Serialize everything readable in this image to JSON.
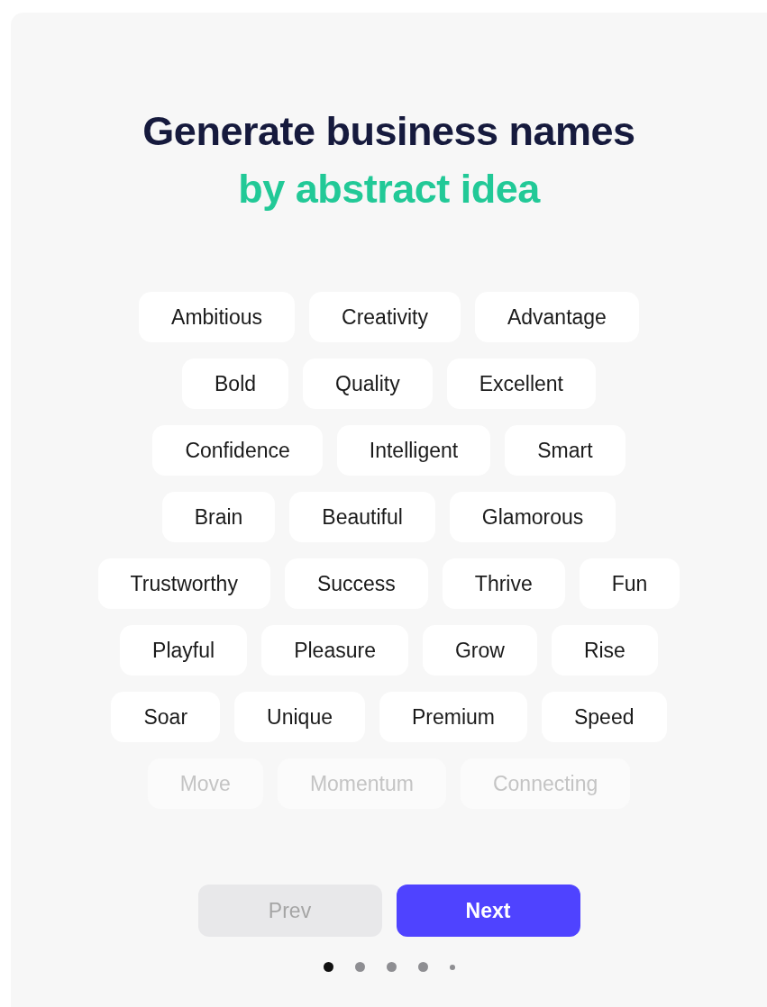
{
  "title": {
    "line1": "Generate business names",
    "line2": "by abstract idea"
  },
  "tag_rows": [
    {
      "tags": [
        {
          "label": "Ambitious",
          "faded": false
        },
        {
          "label": "Creativity",
          "faded": false
        },
        {
          "label": "Advantage",
          "faded": false
        }
      ]
    },
    {
      "tags": [
        {
          "label": "Bold",
          "faded": false
        },
        {
          "label": "Quality",
          "faded": false
        },
        {
          "label": "Excellent",
          "faded": false
        }
      ]
    },
    {
      "tags": [
        {
          "label": "Confidence",
          "faded": false
        },
        {
          "label": "Intelligent",
          "faded": false
        },
        {
          "label": "Smart",
          "faded": false
        }
      ]
    },
    {
      "tags": [
        {
          "label": "Brain",
          "faded": false
        },
        {
          "label": "Beautiful",
          "faded": false
        },
        {
          "label": "Glamorous",
          "faded": false
        }
      ]
    },
    {
      "tags": [
        {
          "label": "Trustworthy",
          "faded": false
        },
        {
          "label": "Success",
          "faded": false
        },
        {
          "label": "Thrive",
          "faded": false
        },
        {
          "label": "Fun",
          "faded": false
        }
      ]
    },
    {
      "tags": [
        {
          "label": "Playful",
          "faded": false
        },
        {
          "label": "Pleasure",
          "faded": false
        },
        {
          "label": "Grow",
          "faded": false
        },
        {
          "label": "Rise",
          "faded": false
        }
      ]
    },
    {
      "tags": [
        {
          "label": "Soar",
          "faded": false
        },
        {
          "label": "Unique",
          "faded": false
        },
        {
          "label": "Premium",
          "faded": false
        },
        {
          "label": "Speed",
          "faded": false
        }
      ]
    },
    {
      "tags": [
        {
          "label": "Move",
          "faded": true
        },
        {
          "label": "Momentum",
          "faded": true
        },
        {
          "label": "Connecting",
          "faded": true
        }
      ]
    }
  ],
  "buttons": [
    {
      "label": "Prev",
      "kind": "secondary",
      "disabled": true
    },
    {
      "label": "Next",
      "kind": "primary",
      "disabled": false
    }
  ],
  "pager_dots": [
    {
      "selected": true,
      "kind": "regular"
    },
    {
      "selected": false,
      "kind": "regular"
    },
    {
      "selected": false,
      "kind": "regular"
    },
    {
      "selected": false,
      "kind": "regular"
    },
    {
      "selected": false,
      "kind": "small"
    }
  ]
}
